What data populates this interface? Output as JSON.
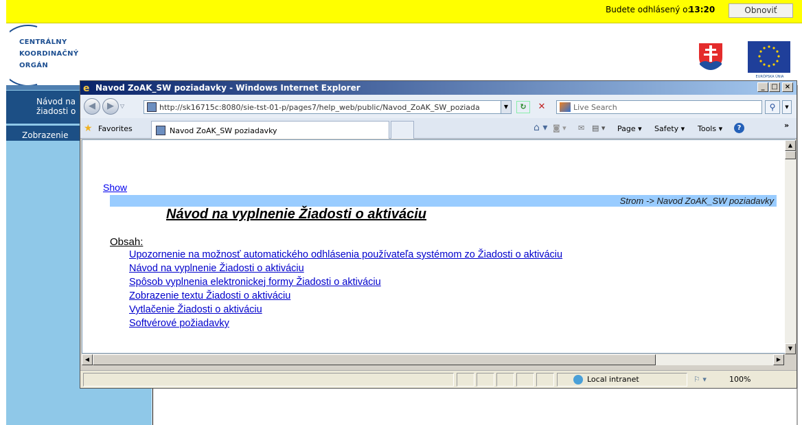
{
  "app": {
    "logout_label": "Budete odhlásený o:",
    "logout_time": "13:20",
    "refresh_label": "Obnoviť",
    "logo_lines": [
      "CENTRÁLNY",
      "KOORDINAČNÝ",
      "ORGÁN"
    ],
    "eu_caption": "EURÓPSKA ÚNIA",
    "nav": {
      "item1_line1": "Návod na",
      "item1_line2": "žiadosti o",
      "item2": "Zobrazenie"
    },
    "colors": {
      "topbar": "#ffff00",
      "nav_dark": "#1c4f85",
      "side_light": "#8fc8e8"
    }
  },
  "browser": {
    "title": "Navod ZoAK_SW poziadavky - Windows Internet Explorer",
    "address": "http://sk16715c:8080/sie-tst-01-p/pages7/help_web/public/Navod_ZoAK_SW_poziada",
    "search_placeholder": "Live Search",
    "favorites_label": "Favorites",
    "tab_title": "Navod ZoAK_SW poziadavky",
    "commands": {
      "page": "Page ▾",
      "safety": "Safety ▾",
      "tools": "Tools ▾"
    },
    "status": {
      "zone": "Local intranet",
      "zoom": "100%"
    }
  },
  "page": {
    "show_link": "Show",
    "breadcrumb": "Strom   -> Navod ZoAK_SW poziadavky",
    "heading": "Návod na vyplnenie Žiadosti o aktiváciu",
    "toc_title": "Obsah:",
    "toc_items": [
      "Upozornenie na možnosť automatického odhlásenia používateľa systémom zo Žiadosti o aktiváciu",
      "Návod na vyplnenie Žiadosti o aktiváciu",
      "Spôsob vyplnenia elektronickej formy Žiadosti o aktiváciu",
      "Zobrazenie textu Žiadosti o aktiváciu",
      "Vytlačenie Žiadosti o aktiváciu",
      "Softvérové požiadavky"
    ]
  }
}
